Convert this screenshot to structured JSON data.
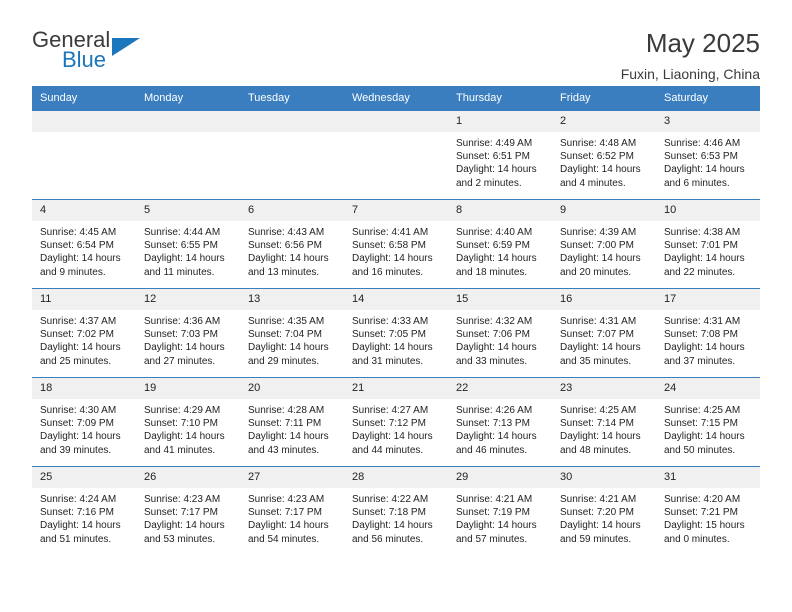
{
  "brand": {
    "name_top": "General",
    "name_bottom": "Blue"
  },
  "header": {
    "title": "May 2025",
    "location": "Fuxin, Liaoning, China"
  },
  "calendar": {
    "weekdays": [
      "Sunday",
      "Monday",
      "Tuesday",
      "Wednesday",
      "Thursday",
      "Friday",
      "Saturday"
    ],
    "accent_color": "#3a7ebf",
    "daynum_bg": "#f0f0f0",
    "weeks": [
      [
        {
          "day": "",
          "empty": true
        },
        {
          "day": "",
          "empty": true
        },
        {
          "day": "",
          "empty": true
        },
        {
          "day": "",
          "empty": true
        },
        {
          "day": "1",
          "sunrise": "Sunrise: 4:49 AM",
          "sunset": "Sunset: 6:51 PM",
          "daylight1": "Daylight: 14 hours",
          "daylight2": "and 2 minutes."
        },
        {
          "day": "2",
          "sunrise": "Sunrise: 4:48 AM",
          "sunset": "Sunset: 6:52 PM",
          "daylight1": "Daylight: 14 hours",
          "daylight2": "and 4 minutes."
        },
        {
          "day": "3",
          "sunrise": "Sunrise: 4:46 AM",
          "sunset": "Sunset: 6:53 PM",
          "daylight1": "Daylight: 14 hours",
          "daylight2": "and 6 minutes."
        }
      ],
      [
        {
          "day": "4",
          "sunrise": "Sunrise: 4:45 AM",
          "sunset": "Sunset: 6:54 PM",
          "daylight1": "Daylight: 14 hours",
          "daylight2": "and 9 minutes."
        },
        {
          "day": "5",
          "sunrise": "Sunrise: 4:44 AM",
          "sunset": "Sunset: 6:55 PM",
          "daylight1": "Daylight: 14 hours",
          "daylight2": "and 11 minutes."
        },
        {
          "day": "6",
          "sunrise": "Sunrise: 4:43 AM",
          "sunset": "Sunset: 6:56 PM",
          "daylight1": "Daylight: 14 hours",
          "daylight2": "and 13 minutes."
        },
        {
          "day": "7",
          "sunrise": "Sunrise: 4:41 AM",
          "sunset": "Sunset: 6:58 PM",
          "daylight1": "Daylight: 14 hours",
          "daylight2": "and 16 minutes."
        },
        {
          "day": "8",
          "sunrise": "Sunrise: 4:40 AM",
          "sunset": "Sunset: 6:59 PM",
          "daylight1": "Daylight: 14 hours",
          "daylight2": "and 18 minutes."
        },
        {
          "day": "9",
          "sunrise": "Sunrise: 4:39 AM",
          "sunset": "Sunset: 7:00 PM",
          "daylight1": "Daylight: 14 hours",
          "daylight2": "and 20 minutes."
        },
        {
          "day": "10",
          "sunrise": "Sunrise: 4:38 AM",
          "sunset": "Sunset: 7:01 PM",
          "daylight1": "Daylight: 14 hours",
          "daylight2": "and 22 minutes."
        }
      ],
      [
        {
          "day": "11",
          "sunrise": "Sunrise: 4:37 AM",
          "sunset": "Sunset: 7:02 PM",
          "daylight1": "Daylight: 14 hours",
          "daylight2": "and 25 minutes."
        },
        {
          "day": "12",
          "sunrise": "Sunrise: 4:36 AM",
          "sunset": "Sunset: 7:03 PM",
          "daylight1": "Daylight: 14 hours",
          "daylight2": "and 27 minutes."
        },
        {
          "day": "13",
          "sunrise": "Sunrise: 4:35 AM",
          "sunset": "Sunset: 7:04 PM",
          "daylight1": "Daylight: 14 hours",
          "daylight2": "and 29 minutes."
        },
        {
          "day": "14",
          "sunrise": "Sunrise: 4:33 AM",
          "sunset": "Sunset: 7:05 PM",
          "daylight1": "Daylight: 14 hours",
          "daylight2": "and 31 minutes."
        },
        {
          "day": "15",
          "sunrise": "Sunrise: 4:32 AM",
          "sunset": "Sunset: 7:06 PM",
          "daylight1": "Daylight: 14 hours",
          "daylight2": "and 33 minutes."
        },
        {
          "day": "16",
          "sunrise": "Sunrise: 4:31 AM",
          "sunset": "Sunset: 7:07 PM",
          "daylight1": "Daylight: 14 hours",
          "daylight2": "and 35 minutes."
        },
        {
          "day": "17",
          "sunrise": "Sunrise: 4:31 AM",
          "sunset": "Sunset: 7:08 PM",
          "daylight1": "Daylight: 14 hours",
          "daylight2": "and 37 minutes."
        }
      ],
      [
        {
          "day": "18",
          "sunrise": "Sunrise: 4:30 AM",
          "sunset": "Sunset: 7:09 PM",
          "daylight1": "Daylight: 14 hours",
          "daylight2": "and 39 minutes."
        },
        {
          "day": "19",
          "sunrise": "Sunrise: 4:29 AM",
          "sunset": "Sunset: 7:10 PM",
          "daylight1": "Daylight: 14 hours",
          "daylight2": "and 41 minutes."
        },
        {
          "day": "20",
          "sunrise": "Sunrise: 4:28 AM",
          "sunset": "Sunset: 7:11 PM",
          "daylight1": "Daylight: 14 hours",
          "daylight2": "and 43 minutes."
        },
        {
          "day": "21",
          "sunrise": "Sunrise: 4:27 AM",
          "sunset": "Sunset: 7:12 PM",
          "daylight1": "Daylight: 14 hours",
          "daylight2": "and 44 minutes."
        },
        {
          "day": "22",
          "sunrise": "Sunrise: 4:26 AM",
          "sunset": "Sunset: 7:13 PM",
          "daylight1": "Daylight: 14 hours",
          "daylight2": "and 46 minutes."
        },
        {
          "day": "23",
          "sunrise": "Sunrise: 4:25 AM",
          "sunset": "Sunset: 7:14 PM",
          "daylight1": "Daylight: 14 hours",
          "daylight2": "and 48 minutes."
        },
        {
          "day": "24",
          "sunrise": "Sunrise: 4:25 AM",
          "sunset": "Sunset: 7:15 PM",
          "daylight1": "Daylight: 14 hours",
          "daylight2": "and 50 minutes."
        }
      ],
      [
        {
          "day": "25",
          "sunrise": "Sunrise: 4:24 AM",
          "sunset": "Sunset: 7:16 PM",
          "daylight1": "Daylight: 14 hours",
          "daylight2": "and 51 minutes."
        },
        {
          "day": "26",
          "sunrise": "Sunrise: 4:23 AM",
          "sunset": "Sunset: 7:17 PM",
          "daylight1": "Daylight: 14 hours",
          "daylight2": "and 53 minutes."
        },
        {
          "day": "27",
          "sunrise": "Sunrise: 4:23 AM",
          "sunset": "Sunset: 7:17 PM",
          "daylight1": "Daylight: 14 hours",
          "daylight2": "and 54 minutes."
        },
        {
          "day": "28",
          "sunrise": "Sunrise: 4:22 AM",
          "sunset": "Sunset: 7:18 PM",
          "daylight1": "Daylight: 14 hours",
          "daylight2": "and 56 minutes."
        },
        {
          "day": "29",
          "sunrise": "Sunrise: 4:21 AM",
          "sunset": "Sunset: 7:19 PM",
          "daylight1": "Daylight: 14 hours",
          "daylight2": "and 57 minutes."
        },
        {
          "day": "30",
          "sunrise": "Sunrise: 4:21 AM",
          "sunset": "Sunset: 7:20 PM",
          "daylight1": "Daylight: 14 hours",
          "daylight2": "and 59 minutes."
        },
        {
          "day": "31",
          "sunrise": "Sunrise: 4:20 AM",
          "sunset": "Sunset: 7:21 PM",
          "daylight1": "Daylight: 15 hours",
          "daylight2": "and 0 minutes."
        }
      ]
    ]
  }
}
